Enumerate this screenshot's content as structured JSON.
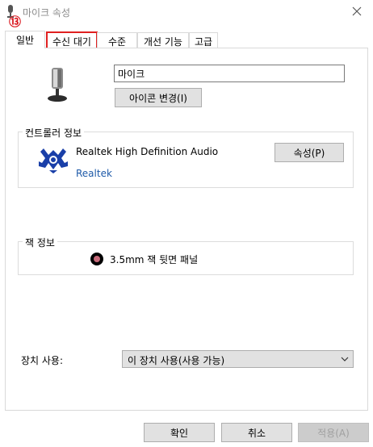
{
  "window": {
    "title": "마이크 속성",
    "close_glyph": "✕"
  },
  "annotation": {
    "marker": "⑬"
  },
  "tabs": [
    {
      "label": "일반"
    },
    {
      "label": "수신 대기"
    },
    {
      "label": "수준"
    },
    {
      "label": "개선 기능"
    },
    {
      "label": "고급"
    }
  ],
  "general": {
    "name_value": "마이크",
    "change_icon_label": "아이콘 변경(I)"
  },
  "controller": {
    "group_label": "컨트롤러 정보",
    "device_name": "Realtek High Definition Audio",
    "vendor": "Realtek",
    "properties_label": "속성(P)"
  },
  "jack": {
    "group_label": "잭 정보",
    "jack_text": "3.5mm 잭 뒷면 패널",
    "jack_color": "#c76a7a"
  },
  "usage": {
    "label": "장치 사용:",
    "selected": "이 장치 사용(사용 가능)"
  },
  "footer": {
    "ok_label": "확인",
    "cancel_label": "취소",
    "apply_label": "적용(A)"
  }
}
